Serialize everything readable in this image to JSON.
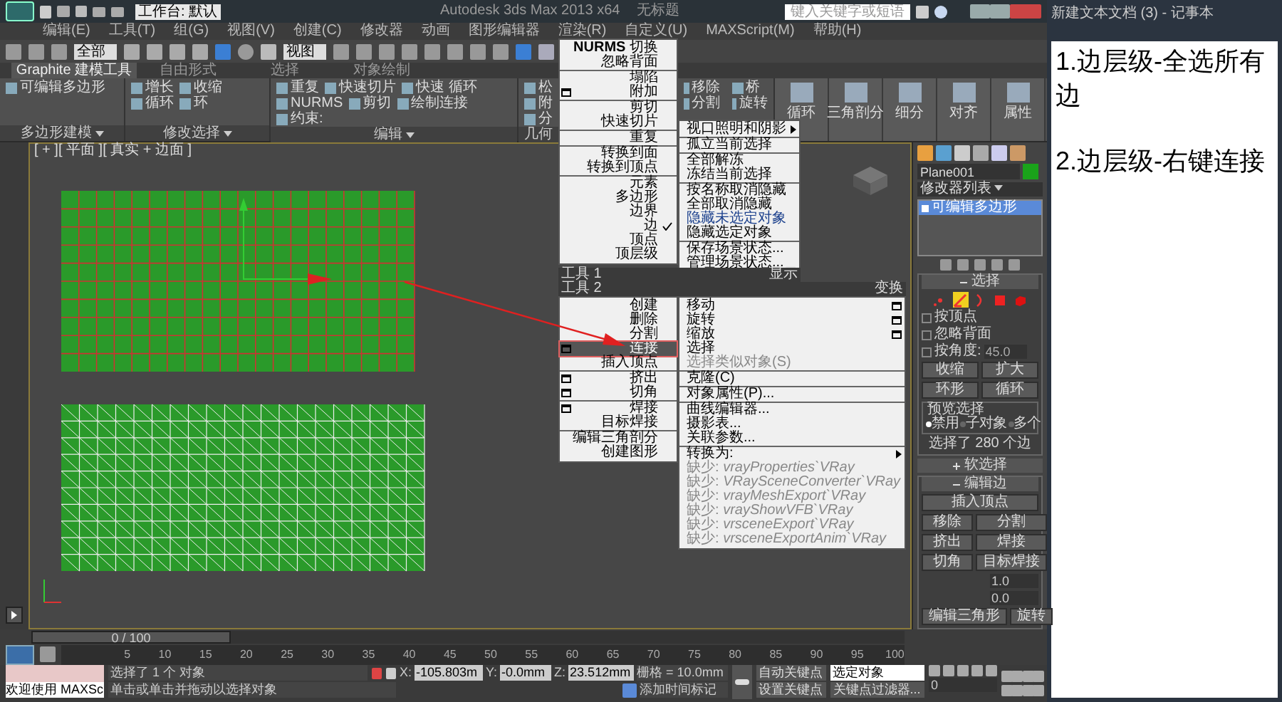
{
  "title_bar": {
    "workspace": "工作台: 默认",
    "title": "Autodesk 3ds Max 2013 x64",
    "document": "无标题",
    "search": {
      "placeholder": "键入关键字或短语"
    }
  },
  "menu_bar": [
    "编辑(E)",
    "工具(T)",
    "组(G)",
    "视图(V)",
    "创建(C)",
    "修改器",
    "动画",
    "图形编辑器",
    "渲染(R)",
    "自定义(U)",
    "MAXScript(M)",
    "帮助(H)"
  ],
  "toolbar": {
    "selection_filter": "全部",
    "reference_coord": "视图"
  },
  "ribbon": {
    "tabs": [
      {
        "label": "Graphite 建模工具",
        "selected": true
      },
      {
        "label": "自由形式",
        "selected": false
      },
      {
        "label": "选择",
        "selected": false
      },
      {
        "label": "对象绘制",
        "selected": false
      }
    ],
    "panels": [
      {
        "title": "多边形建模",
        "items": [
          "可编辑多边形"
        ]
      },
      {
        "title": "修改选择",
        "items": [
          "增长",
          "收缩",
          "循环",
          "环"
        ]
      },
      {
        "title": "编辑",
        "items": [
          "重复",
          "快速切片",
          "快速 循环",
          "NURMS",
          "剪切",
          "绘制连接",
          "约束:"
        ]
      },
      {
        "title": "几何",
        "items": [
          "松",
          "附",
          "分",
          "移除",
          "分割",
          "桥",
          "旋转"
        ]
      }
    ],
    "big_buttons": [
      "循环",
      "三角剖分",
      "细分",
      "对齐",
      "属性"
    ]
  },
  "viewport": {
    "label": "[ + ][ 平面 ][ 真实 + 边面 ]"
  },
  "quad_menu": {
    "header_1": {
      "left": "工具 1",
      "right": "显示"
    },
    "header_2": {
      "left": "工具 2",
      "right": "变换"
    },
    "upper_left": [
      {
        "label": "**NURMS** 切换",
        "selected": false,
        "checked": false
      },
      {
        "label": "忽略背面",
        "selected": false,
        "checked": false
      },
      {
        "label": "塌陷",
        "selected": false,
        "checked": false,
        "divider": true
      },
      {
        "label": "附加",
        "selected": false,
        "checked": false,
        "options": true
      },
      {
        "label": "剪切",
        "selected": false,
        "checked": false,
        "divider": true
      },
      {
        "label": "快速切片",
        "selected": false,
        "checked": false
      },
      {
        "label": "重复",
        "selected": false,
        "checked": false,
        "divider": true
      },
      {
        "label": "转换到面",
        "selected": false,
        "checked": false,
        "divider": true
      },
      {
        "label": "转换到顶点",
        "selected": false,
        "checked": false
      },
      {
        "label": "元素",
        "selected": false,
        "checked": false,
        "divider": true
      },
      {
        "label": "多边形",
        "selected": false,
        "checked": false
      },
      {
        "label": "边界",
        "selected": false,
        "checked": false
      },
      {
        "label": "边",
        "selected": false,
        "checked": true
      },
      {
        "label": "顶点",
        "selected": false,
        "checked": false
      },
      {
        "label": "顶层级",
        "selected": false,
        "checked": false
      }
    ],
    "upper_right": [
      {
        "label": "视口照明和阴影",
        "selected": false,
        "submenu": true
      },
      {
        "label": "孤立当前选择",
        "selected": false,
        "divider": true
      },
      {
        "label": "全部解冻",
        "selected": false,
        "divider": true
      },
      {
        "label": "冻结当前选择",
        "selected": false
      },
      {
        "label": "按名称取消隐藏",
        "selected": false,
        "divider": true
      },
      {
        "label": "全部取消隐藏",
        "selected": false
      },
      {
        "label": "隐藏未选定对象",
        "selected": false,
        "color": "#1a3f8c"
      },
      {
        "label": "隐藏选定对象",
        "selected": false
      },
      {
        "label": "保存场景状态...",
        "selected": false,
        "divider": true
      },
      {
        "label": "管理场景状态...",
        "selected": false
      }
    ],
    "lower_left": [
      {
        "label": "创建",
        "selected": false
      },
      {
        "label": "删除",
        "selected": false
      },
      {
        "label": "分割",
        "selected": false
      },
      {
        "label": "连接",
        "selected": true,
        "options": true
      },
      {
        "label": "插入顶点",
        "selected": false
      },
      {
        "label": "挤出",
        "selected": false,
        "options": true,
        "divider": true
      },
      {
        "label": "切角",
        "selected": false,
        "options": true
      },
      {
        "label": "焊接",
        "selected": false,
        "options": true,
        "divider": true
      },
      {
        "label": "目标焊接",
        "selected": false
      },
      {
        "label": "编辑三角剖分",
        "selected": false,
        "divider": true
      },
      {
        "label": "创建图形",
        "selected": false
      }
    ],
    "lower_right": [
      {
        "label": "移动",
        "selected": false,
        "disabled": false,
        "options": true
      },
      {
        "label": "旋转",
        "selected": false,
        "disabled": false,
        "options": true
      },
      {
        "label": "缩放",
        "selected": false,
        "disabled": false,
        "options": true
      },
      {
        "label": "选择",
        "selected": false,
        "disabled": false
      },
      {
        "label": "选择类似对象(S)",
        "selected": false,
        "disabled": true
      },
      {
        "label": "克隆(C)",
        "selected": false,
        "disabled": false,
        "divider": true
      },
      {
        "label": "对象属性(P)...",
        "selected": false,
        "disabled": false,
        "divider": true
      },
      {
        "label": "曲线编辑器...",
        "selected": false,
        "disabled": false,
        "divider": true
      },
      {
        "label": "摄影表...",
        "selected": false,
        "disabled": false
      },
      {
        "label": "关联参数...",
        "selected": false,
        "disabled": false
      },
      {
        "label": "转换为:",
        "selected": false,
        "disabled": false,
        "submenu": true,
        "divider": true
      },
      {
        "label": "缺少: *vrayProperties`VRay*",
        "selected": false,
        "disabled": true
      },
      {
        "label": "缺少: *VRaySceneConverter`VRay*",
        "selected": false,
        "disabled": true
      },
      {
        "label": "缺少: *vrayMeshExport`VRay*",
        "selected": false,
        "disabled": true
      },
      {
        "label": "缺少: *vrayShowVFB`VRay*",
        "selected": false,
        "disabled": true
      },
      {
        "label": "缺少: *vrsceneExport`VRay*",
        "selected": false,
        "disabled": true
      },
      {
        "label": "缺少: *vrsceneExportAnim`VRay*",
        "selected": false,
        "disabled": true
      }
    ]
  },
  "command_panel": {
    "object_name": "Plane001",
    "modifier_list": "修改器列表",
    "stack": [
      {
        "label": "可编辑多边形",
        "selected": true
      }
    ],
    "selection": {
      "title": "选择",
      "expanded": true,
      "levels": [
        {
          "kind": "vertex",
          "selected": false
        },
        {
          "kind": "edge",
          "selected": true
        },
        {
          "kind": "border",
          "selected": false
        },
        {
          "kind": "polygon",
          "selected": false
        },
        {
          "kind": "element",
          "selected": false
        }
      ],
      "checks": [
        {
          "label": "按顶点",
          "checked": false
        },
        {
          "label": "忽略背面",
          "checked": false
        },
        {
          "label": "按角度:",
          "checked": false,
          "value": "45.0"
        }
      ],
      "buttons": [
        "收缩",
        "扩大",
        "环形",
        "循环"
      ],
      "preview": {
        "title": "预览选择",
        "options": [
          {
            "label": "禁用",
            "selected": true
          },
          {
            "label": "子对象",
            "selected": false
          },
          {
            "label": "多个",
            "selected": false
          }
        ]
      },
      "status": "选择了 280 个边"
    },
    "soft_selection": {
      "title": "软选择",
      "expanded": false
    },
    "edit_edges": {
      "title": "编辑边",
      "expanded": true,
      "buttons": [
        "插入顶点",
        "移除",
        "分割",
        "挤出",
        "焊接",
        "切角",
        "目标焊接"
      ],
      "fields": [
        "1.0",
        "0.0"
      ],
      "bottom_buttons": [
        "编辑三角形",
        "旋转"
      ]
    }
  },
  "timeline": {
    "slider": {
      "label": "0 / 100",
      "level": 0
    },
    "ticks": [
      "5",
      "10",
      "15",
      "20",
      "25",
      "30",
      "35",
      "40",
      "45",
      "50",
      "55",
      "60",
      "65",
      "70",
      "75",
      "80",
      "85",
      "90",
      "95",
      "100"
    ]
  },
  "status_bar": {
    "welcome": "欢迎使用 MAXSc",
    "selection": "选择了 1 个 对象",
    "prompt": "单击或单击并拖动以选择对象",
    "coords": [
      {
        "label": "X:",
        "value": "-105.803m"
      },
      {
        "label": "Y:",
        "value": "-0.0mm"
      },
      {
        "label": "Z:",
        "value": "23.512mm"
      }
    ],
    "grid": "栅格 = 10.0mm",
    "time_tag": "添加时间标记",
    "auto_key": "自动关键点",
    "set_key": "设置关键点",
    "key_target": "选定对象",
    "key_filters": "关键点过滤器...",
    "frame": "0"
  },
  "notepad": {
    "title": "新建文本文档 (3) - 记事本",
    "lines": [
      "1.边层级-全选所有边",
      "2.边层级-右键连接"
    ]
  }
}
